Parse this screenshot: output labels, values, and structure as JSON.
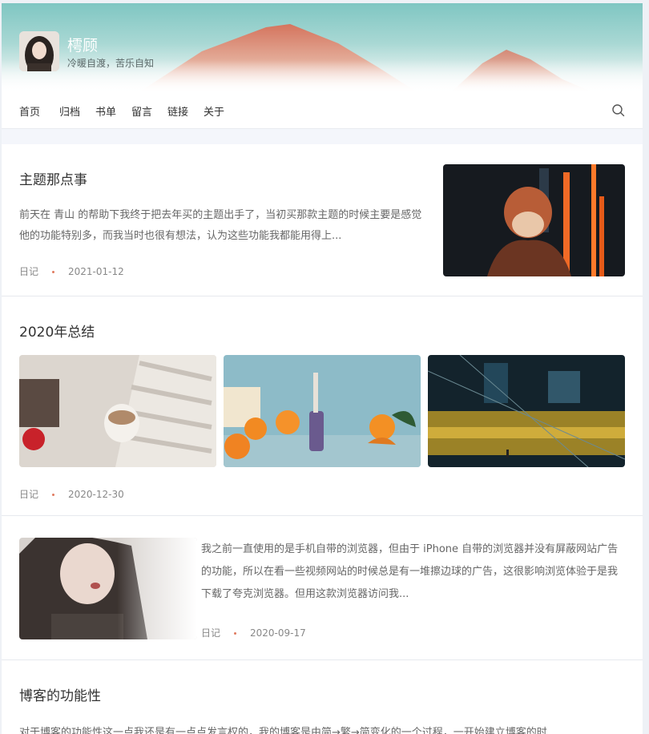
{
  "site": {
    "title": "樗顾",
    "subtitle": "冷暖自渡，苦乐自知"
  },
  "nav": {
    "items": [
      "首页",
      "归档",
      "书单",
      "留言",
      "链接",
      "关于"
    ],
    "search_icon": "search-icon"
  },
  "posts": [
    {
      "title": "主题那点事",
      "excerpt": "前天在 青山 的帮助下我终于把去年买的主题出手了，当初买那款主题的时候主要是感觉他的功能特别多，而我当时也很有想法，认为这些功能我都能用得上...",
      "category": "日记",
      "date": "2021-01-12"
    },
    {
      "title": "2020年总结",
      "category": "日记",
      "date": "2020-12-30"
    },
    {
      "excerpt": "我之前一直使用的是手机自带的浏览器，但由于 iPhone 自带的浏览器并没有屏蔽网站广告的功能，所以在看一些视频网站的时候总是有一堆擦边球的广告，这很影响浏览体验于是我下载了夸克浏览器。但用这款浏览器访问我...",
      "category": "日记",
      "date": "2020-09-17"
    },
    {
      "title": "博客的功能性",
      "excerpt": "对于博客的功能性这一点我还是有一点点发言权的，我的博客是由简→繁→简变化的一个过程，一开始建立博客的时"
    }
  ],
  "colors": {
    "accent_dot": "#e07b5f",
    "header_sky": "#7fc6c2"
  }
}
